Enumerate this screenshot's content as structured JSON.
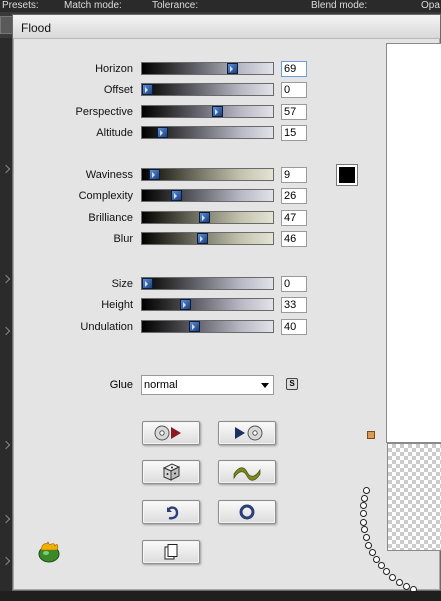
{
  "host": {
    "top_labels": [
      "Presets:",
      "Match mode:",
      "Tolerance:",
      "Blend mode:",
      "Opa"
    ]
  },
  "dialog": {
    "title": "Flood",
    "groups": [
      {
        "rows": [
          {
            "label": "Horizon",
            "value": "69",
            "fraction": 0.69,
            "style": "grey",
            "focus": true
          },
          {
            "label": "Offset",
            "value": "0",
            "fraction": 0.0,
            "style": "grey",
            "focus": false
          },
          {
            "label": "Perspective",
            "value": "57",
            "fraction": 0.57,
            "style": "grey",
            "focus": false
          },
          {
            "label": "Altitude",
            "value": "15",
            "fraction": 0.15,
            "style": "grey",
            "focus": false
          }
        ]
      },
      {
        "rows": [
          {
            "label": "Waviness",
            "value": "9",
            "fraction": 0.09,
            "style": "beige",
            "focus": false
          },
          {
            "label": "Complexity",
            "value": "26",
            "fraction": 0.26,
            "style": "grey",
            "focus": false
          },
          {
            "label": "Brilliance",
            "value": "47",
            "fraction": 0.47,
            "style": "beige",
            "focus": false
          },
          {
            "label": "Blur",
            "value": "46",
            "fraction": 0.46,
            "style": "beige",
            "focus": false
          }
        ]
      },
      {
        "rows": [
          {
            "label": "Size",
            "value": "0",
            "fraction": 0.0,
            "style": "grey",
            "focus": false
          },
          {
            "label": "Height",
            "value": "33",
            "fraction": 0.33,
            "style": "grey",
            "focus": false
          },
          {
            "label": "Undulation",
            "value": "40",
            "fraction": 0.4,
            "style": "grey",
            "focus": false
          }
        ]
      }
    ],
    "color_swatch": "#000000",
    "glue": {
      "label": "Glue",
      "value": "normal"
    },
    "buttons": [
      {
        "name": "preset-save-button",
        "icon": "disc-play-icon"
      },
      {
        "name": "preset-load-button",
        "icon": "play-disc-icon"
      },
      {
        "name": "randomize-button",
        "icon": "dice-icon"
      },
      {
        "name": "wave-button",
        "icon": "wave-icon"
      },
      {
        "name": "undo-button",
        "icon": "undo-icon"
      },
      {
        "name": "reset-button",
        "icon": "ring-icon"
      },
      {
        "name": "copy-button",
        "icon": "copy-icon"
      }
    ]
  }
}
